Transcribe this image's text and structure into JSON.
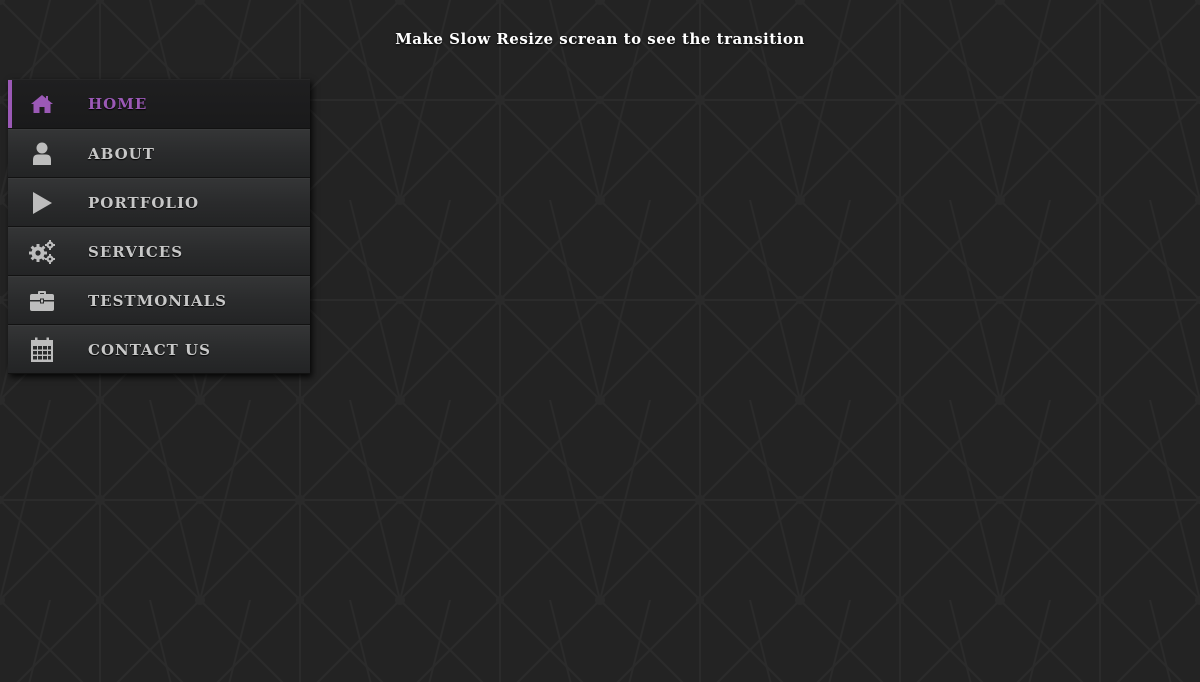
{
  "banner": {
    "text": "Make Slow Resize screan to see the transition"
  },
  "colors": {
    "background": "#232323",
    "accent": "#9b59b6",
    "label": "#c7c7c7",
    "icon": "#bdbdbd",
    "banner_text": "#ffffff"
  },
  "menu": {
    "items": [
      {
        "label": "HOME",
        "icon": "home-icon",
        "active": true
      },
      {
        "label": "ABOUT",
        "icon": "user-icon",
        "active": false
      },
      {
        "label": "PORTFOLIO",
        "icon": "play-icon",
        "active": false
      },
      {
        "label": "SERVICES",
        "icon": "gears-icon",
        "active": false
      },
      {
        "label": "TESTMONIALS",
        "icon": "briefcase-icon",
        "active": false
      },
      {
        "label": "CONTACT US",
        "icon": "calendar-icon",
        "active": false
      }
    ]
  }
}
